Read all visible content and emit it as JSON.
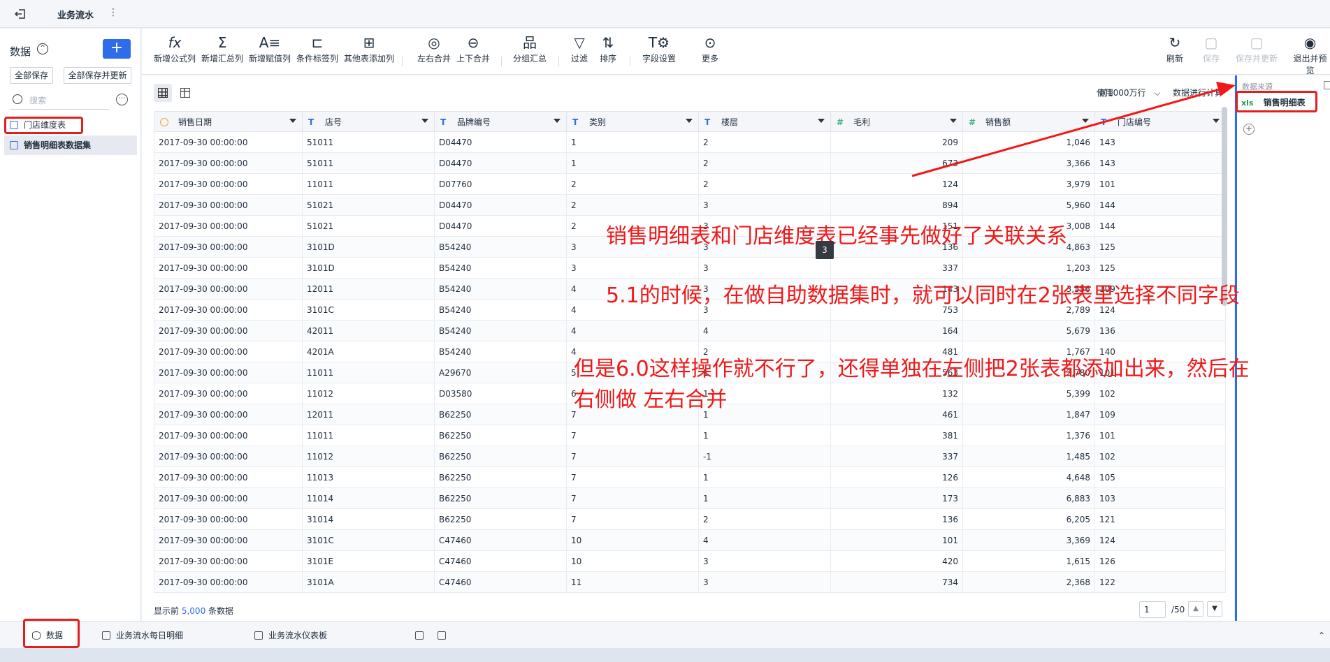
{
  "topbar": {
    "title": "业务流水",
    "menu_glyph": "⋮"
  },
  "left": {
    "header": "数据",
    "add_label": "+",
    "save_all": "全部保存",
    "save_update_all": "全部保存并更新",
    "search_placeholder": "搜索",
    "more_glyph": "⋯",
    "items": [
      {
        "label": "门店维度表"
      },
      {
        "label": "销售明细表数据集"
      }
    ]
  },
  "toolbar": {
    "buttons": [
      {
        "glyph": "fx",
        "label": "新增公式列"
      },
      {
        "glyph": "Σ",
        "label": "新增汇总列"
      },
      {
        "glyph": "A≡",
        "label": "新增赋值列"
      },
      {
        "glyph": "⊏",
        "label": "条件标签列"
      },
      {
        "glyph": "⊞",
        "label": "其他表添加列"
      },
      {
        "glyph": "◎",
        "label": "左右合并"
      },
      {
        "glyph": "⊖",
        "label": "上下合并"
      },
      {
        "glyph": "品",
        "label": "分组汇总"
      },
      {
        "glyph": "▽",
        "label": "过滤"
      },
      {
        "glyph": "⇅",
        "label": "排序"
      },
      {
        "glyph": "T⚙",
        "label": "字段设置"
      },
      {
        "glyph": "⊙",
        "label": "更多"
      }
    ],
    "right_buttons": [
      {
        "glyph": "↻",
        "label": "刷新"
      },
      {
        "glyph": "▢",
        "label": "保存"
      },
      {
        "glyph": "▢",
        "label": "保存并更新"
      },
      {
        "glyph": "◉",
        "label": "退出并预览"
      }
    ]
  },
  "main": {
    "use_label": "使用",
    "use_value": "前1000万行",
    "compute_label": "数据进行计算",
    "columns": [
      {
        "type": "date",
        "name": "销售日期"
      },
      {
        "type": "text",
        "name": "店号"
      },
      {
        "type": "text",
        "name": "品牌编号"
      },
      {
        "type": "text",
        "name": "类别"
      },
      {
        "type": "text",
        "name": "楼层"
      },
      {
        "type": "number",
        "name": "毛利"
      },
      {
        "type": "number",
        "name": "销售额"
      },
      {
        "type": "text",
        "name": "门店编号"
      }
    ],
    "rows": [
      [
        "2017-09-30 00:00:00",
        "51011",
        "D04470",
        "1",
        "2",
        "209",
        "1,046",
        "143"
      ],
      [
        "2017-09-30 00:00:00",
        "51011",
        "D04470",
        "1",
        "2",
        "673",
        "3,366",
        "143"
      ],
      [
        "2017-09-30 00:00:00",
        "11011",
        "D07760",
        "2",
        "2",
        "124",
        "3,979",
        "101"
      ],
      [
        "2017-09-30 00:00:00",
        "51021",
        "D04470",
        "2",
        "3",
        "894",
        "5,960",
        "144"
      ],
      [
        "2017-09-30 00:00:00",
        "51021",
        "D04470",
        "2",
        "3",
        "151",
        "3,008",
        "144"
      ],
      [
        "2017-09-30 00:00:00",
        "3101D",
        "B54240",
        "3",
        "3",
        "136",
        "4,863",
        "125"
      ],
      [
        "2017-09-30 00:00:00",
        "3101D",
        "B54240",
        "3",
        "3",
        "337",
        "1,203",
        "125"
      ],
      [
        "2017-09-30 00:00:00",
        "12011",
        "B54240",
        "4",
        "3",
        "143",
        "3,556",
        "109"
      ],
      [
        "2017-09-30 00:00:00",
        "3101C",
        "B54240",
        "4",
        "3",
        "753",
        "2,789",
        "124"
      ],
      [
        "2017-09-30 00:00:00",
        "42011",
        "B54240",
        "4",
        "4",
        "164",
        "5,679",
        "136"
      ],
      [
        "2017-09-30 00:00:00",
        "4201A",
        "B54240",
        "4",
        "2",
        "481",
        "1,767",
        "140"
      ],
      [
        "2017-09-30 00:00:00",
        "11011",
        "A29670",
        "5",
        "1",
        "563",
        "2,780",
        "101"
      ],
      [
        "2017-09-30 00:00:00",
        "11012",
        "D03580",
        "6",
        "1",
        "132",
        "5,399",
        "102"
      ],
      [
        "2017-09-30 00:00:00",
        "12011",
        "B62250",
        "7",
        "1",
        "461",
        "1,847",
        "109"
      ],
      [
        "2017-09-30 00:00:00",
        "11011",
        "B62250",
        "7",
        "1",
        "381",
        "1,376",
        "101"
      ],
      [
        "2017-09-30 00:00:00",
        "11012",
        "B62250",
        "7",
        "-1",
        "337",
        "1,485",
        "102"
      ],
      [
        "2017-09-30 00:00:00",
        "11013",
        "B62250",
        "7",
        "1",
        "126",
        "4,648",
        "105"
      ],
      [
        "2017-09-30 00:00:00",
        "11014",
        "B62250",
        "7",
        "1",
        "173",
        "6,883",
        "103"
      ],
      [
        "2017-09-30 00:00:00",
        "31014",
        "B62250",
        "7",
        "2",
        "136",
        "6,205",
        "121"
      ],
      [
        "2017-09-30 00:00:00",
        "3101C",
        "C47460",
        "10",
        "4",
        "101",
        "3,369",
        "124"
      ],
      [
        "2017-09-30 00:00:00",
        "3101E",
        "C47460",
        "10",
        "3",
        "420",
        "1,615",
        "126"
      ],
      [
        "2017-09-30 00:00:00",
        "3101A",
        "C47460",
        "11",
        "3",
        "734",
        "2,368",
        "122"
      ]
    ],
    "footer_prefix": "显示前",
    "footer_count": "5,000",
    "footer_suffix": "条数据",
    "page_current": "1",
    "page_total": "/50"
  },
  "right": {
    "header": "数据来源",
    "file_type": "xls",
    "file_name": "销售明细表"
  },
  "bottom": {
    "tabs": [
      {
        "label": "数据"
      },
      {
        "label": "业务流水每日明细"
      },
      {
        "label": "业务流水仪表板"
      }
    ]
  },
  "annotations": {
    "line1": "销售明细表和门店维度表已经事先做好了关联关系",
    "line2": "5.1的时候，在做自助数据集时，就可以同时在2张表里选择不同字段",
    "line3": "但是6.0这样操作就不行了，还得单独在左侧把2张表都添加出来，然后在",
    "line4": "右侧做    左右合并",
    "badge": "3",
    "color": "#f01818"
  }
}
